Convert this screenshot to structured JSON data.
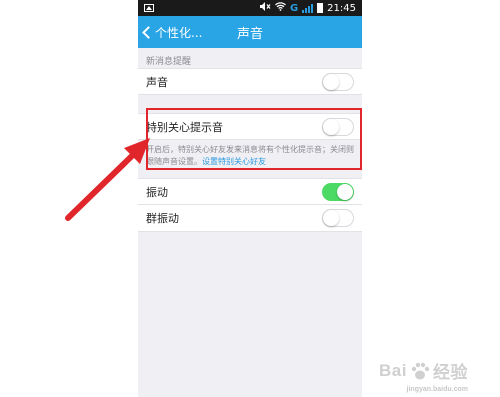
{
  "status_bar": {
    "network": "G",
    "time": "21:45"
  },
  "nav_bar": {
    "back_label": "个性化...",
    "title": "声音"
  },
  "section_header": "新消息提醒",
  "rows": {
    "sound": {
      "label": "声音",
      "on": false
    },
    "special_care_tone": {
      "label": "特别关心提示音",
      "on": false
    },
    "vibrate": {
      "label": "振动",
      "on": true
    },
    "group_vibrate": {
      "label": "群振动",
      "on": false
    }
  },
  "help_text": {
    "body": "开启后，特别关心好友发来消息将有个性化提示音；关闭则跟随声音设置。",
    "link": "设置特别关心好友"
  },
  "colors": {
    "nav_bg": "#29a5e6",
    "toggle_on": "#4cd964",
    "highlight": "#e0262b",
    "arrow": "#e0262b",
    "link": "#2b9be0"
  },
  "watermark": {
    "brand_left": "Bai",
    "brand_right": "经验",
    "sub": "jingyan.baidu.com"
  }
}
